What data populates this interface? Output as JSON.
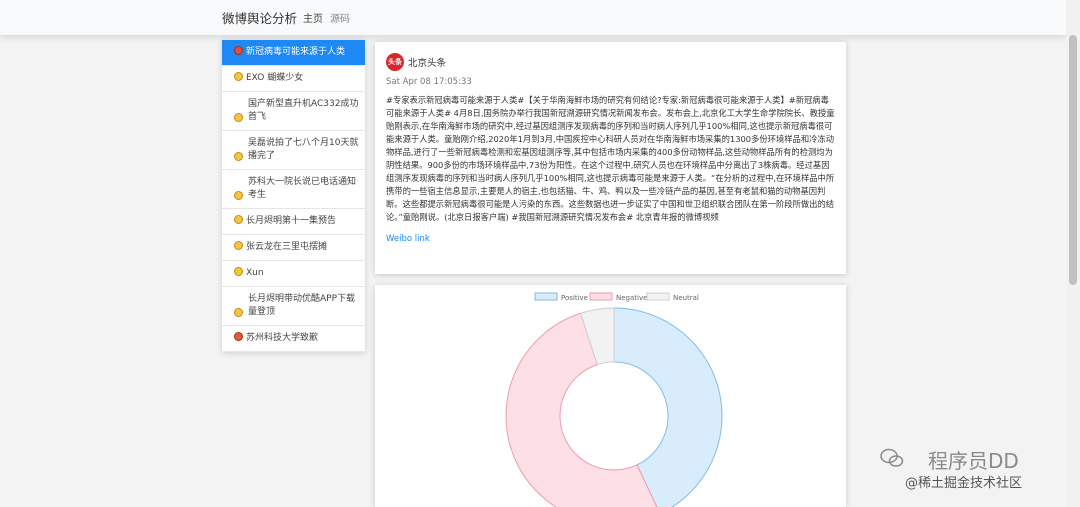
{
  "navbar": {
    "brand": "微博舆论分析",
    "links": [
      "主页",
      "源码"
    ]
  },
  "sidebar": {
    "items": [
      {
        "label": "新冠病毒可能来源于人类",
        "emoji": "red",
        "active": true
      },
      {
        "label": "EXO 蝴蝶少女",
        "emoji": "yellow"
      },
      {
        "label": "国产新型直升机AC332成功首飞",
        "emoji": "yellow"
      },
      {
        "label": "吴磊说拍了七八个月10天就播完了",
        "emoji": "yellow"
      },
      {
        "label": "苏科大一院长说已电话通知考生",
        "emoji": "yellow"
      },
      {
        "label": "长月烬明第十一集预告",
        "emoji": "yellow"
      },
      {
        "label": "张云龙在三里屯摆摊",
        "emoji": "yellow"
      },
      {
        "label": "Xun",
        "emoji": "yellow"
      },
      {
        "label": "长月烬明带动优酷APP下载量登顶",
        "emoji": "yellow"
      },
      {
        "label": "苏州科技大学致歉",
        "emoji": "angry"
      }
    ]
  },
  "post": {
    "author": "北京头条",
    "avatar_text": "头条",
    "time": "Sat Apr 08 17:05:33",
    "content": "#专家表示新冠病毒可能来源于人类#【关于华南海鲜市场的研究有何结论?专家:新冠病毒很可能来源于人类】#新冠病毒可能来源于人类# 4月8日,国务院办举行我国新冠溯源研究情况新闻发布会。发布会上,北京化工大学生命学院院长、教授童贻刚表示,在华南海鲜市场的研究中,经过基因组测序发现病毒的序列和当时病人序列几乎100%相同,这也提示新冠病毒很可能来源于人类。童贻刚介绍,2020年1月到3月,中国疾控中心科研人员对在华南海鲜市场采集的1300多份环境样品和冷冻动物样品,进行了一些新冠病毒检测和宏基因组测序等,其中包括市场内采集的400多份动物样品,这些动物样品所有的检测均为阴性结果。900多份的市场环境样品中,73份为阳性。在这个过程中,研究人员也在环境样品中分离出了3株病毒。经过基因组测序发现病毒的序列和当时病人序列几乎100%相同,这也提示病毒可能是来源于人类。“在分析的过程中,在环境样品中所携带的一些宿主信息显示,主要是人的宿主,也包括猫、牛、鸡、鸭以及一些冷链产品的基因,甚至有老鼠和猫的动物基因判断。这些都提示新冠病毒很可能是人污染的东西。这些数据也进一步证实了中国和世卫组织联合团队在第一阶段所做出的结论。”童贻刚说。(北京日报客户端) #我国新冠溯源研究情况发布会# 北京青年报的微博视频",
    "link_text": "Weibo link"
  },
  "chart_data": {
    "type": "pie",
    "variant": "doughnut",
    "categories": [
      "Positive",
      "Negative",
      "Neutral"
    ],
    "values": [
      43,
      52,
      5
    ],
    "legend_position": "top",
    "colors": {
      "Positive": {
        "fill": "#d8ecfb",
        "stroke": "#7fbde9"
      },
      "Negative": {
        "fill": "#fde0e6",
        "stroke": "#f09aac"
      },
      "Neutral": {
        "fill": "#f2f2f2",
        "stroke": "#cfcfcf"
      }
    }
  },
  "watermark": {
    "line1": "程序员DD",
    "line2": "@稀土掘金技术社区"
  }
}
